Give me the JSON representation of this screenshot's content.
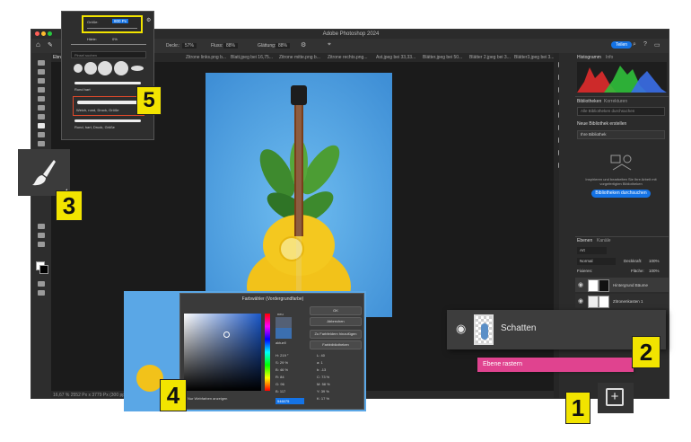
{
  "app": {
    "title": "Adobe Photoshop 2024",
    "status": "16,67 %   2552 Px x 3779 Px (300 ppi)"
  },
  "options_bar": {
    "size_label": "800 Px",
    "size_slider_label": "Größe:",
    "hardness_label": "Härte:",
    "hardness_value": "0%",
    "deckkraft_label": "Deckr.:",
    "deckkraft_value": "57%",
    "fluss_label": "Fluss:",
    "fluss_value": "88%",
    "glaettung_label": "Glättung:",
    "glaettung_value": "88%",
    "share_label": "Teilen"
  },
  "tabs": [
    "Ebne",
    "Zitrone links.png b...",
    "Blatt.jpeg bei 16,75...",
    "Zitrone mitte.png b...",
    "Zitrone rechts.png...",
    "Ast.jpeg bei 33,33...",
    "Blätter.jpeg bei 50...",
    "Blätter 2.jpeg bei 3...",
    "Blätter3.jpeg bei 3..."
  ],
  "brush_popup": {
    "size_label": "Größe:",
    "size_value": "800 Px",
    "hardness_label": "Härte:",
    "hardness_value": "0%",
    "search_placeholder": "Pinsel suchen",
    "brushes": [
      "Rund hart",
      "Weich, rund, Druck, Größe",
      "Rund, hart, Druck, Größe"
    ]
  },
  "histogram": {
    "tab1": "Histogramm",
    "tab2": "Info"
  },
  "libraries": {
    "tab1": "Bibliotheken",
    "tab2": "Korrekturen",
    "search_placeholder": "Alle Bibliotheken durchsuchen",
    "new_library": "Neue Bibliothek erstellen",
    "my_library": "Ihre Bibliothek",
    "hint": "Inspirieren und bearbeiten Sie Ihre Arbeit mit vorgefertigten Bibliotheken",
    "browse_button": "Bibliotheken durchsuchen"
  },
  "layers_panel": {
    "tab1": "Ebenen",
    "tab2": "Kanäle",
    "kind_label": "Art",
    "blend_mode": "Normal",
    "opacity_label": "Deckkraft:",
    "opacity_value": "100%",
    "lock_label": "Fixieren:",
    "fill_label": "Fläche:",
    "fill_value": "100%",
    "layers": [
      "Hintergrund Bäume",
      "Zitronenkasten 1"
    ]
  },
  "shadow_callout": {
    "layer_name": "Schatten",
    "raster_label": "Ebene rastern"
  },
  "color_picker": {
    "title": "Farbwähler (Vordergrundfarbe)",
    "new_label": "neu",
    "current_label": "aktuell",
    "ok": "OK",
    "cancel": "Abbrechen",
    "add_swatches": "Zu Farbfeldern hinzufügen",
    "libraries": "Farbbibliotheken",
    "web_only": "Nur Webfarben anzeigen",
    "fields": [
      {
        "label": "H:",
        "value": "219 °"
      },
      {
        "label": "S:",
        "value": "29 %"
      },
      {
        "label": "B:",
        "value": "46 %"
      },
      {
        "label": "R:",
        "value": "84"
      },
      {
        "label": "G:",
        "value": "96"
      },
      {
        "label": "B:",
        "value": "117"
      }
    ],
    "lab_fields": [
      {
        "label": "L:",
        "value": "40"
      },
      {
        "label": "a:",
        "value": "1"
      },
      {
        "label": "b:",
        "value": "-13"
      },
      {
        "label": "C:",
        "value": "73 %"
      },
      {
        "label": "M:",
        "value": "58 %"
      },
      {
        "label": "Y:",
        "value": "39 %"
      },
      {
        "label": "K:",
        "value": "17 %"
      }
    ],
    "hex": "546075"
  },
  "badges": {
    "b1": "1",
    "b2": "2",
    "b3": "3",
    "b4": "4",
    "b5": "5"
  },
  "colors": {
    "accent": "#1473e6",
    "badge": "#f2e400",
    "raster_pink": "#e0438f",
    "canvas_blue": "#5aa7e6",
    "guitar_yellow": "#f2c21a"
  }
}
